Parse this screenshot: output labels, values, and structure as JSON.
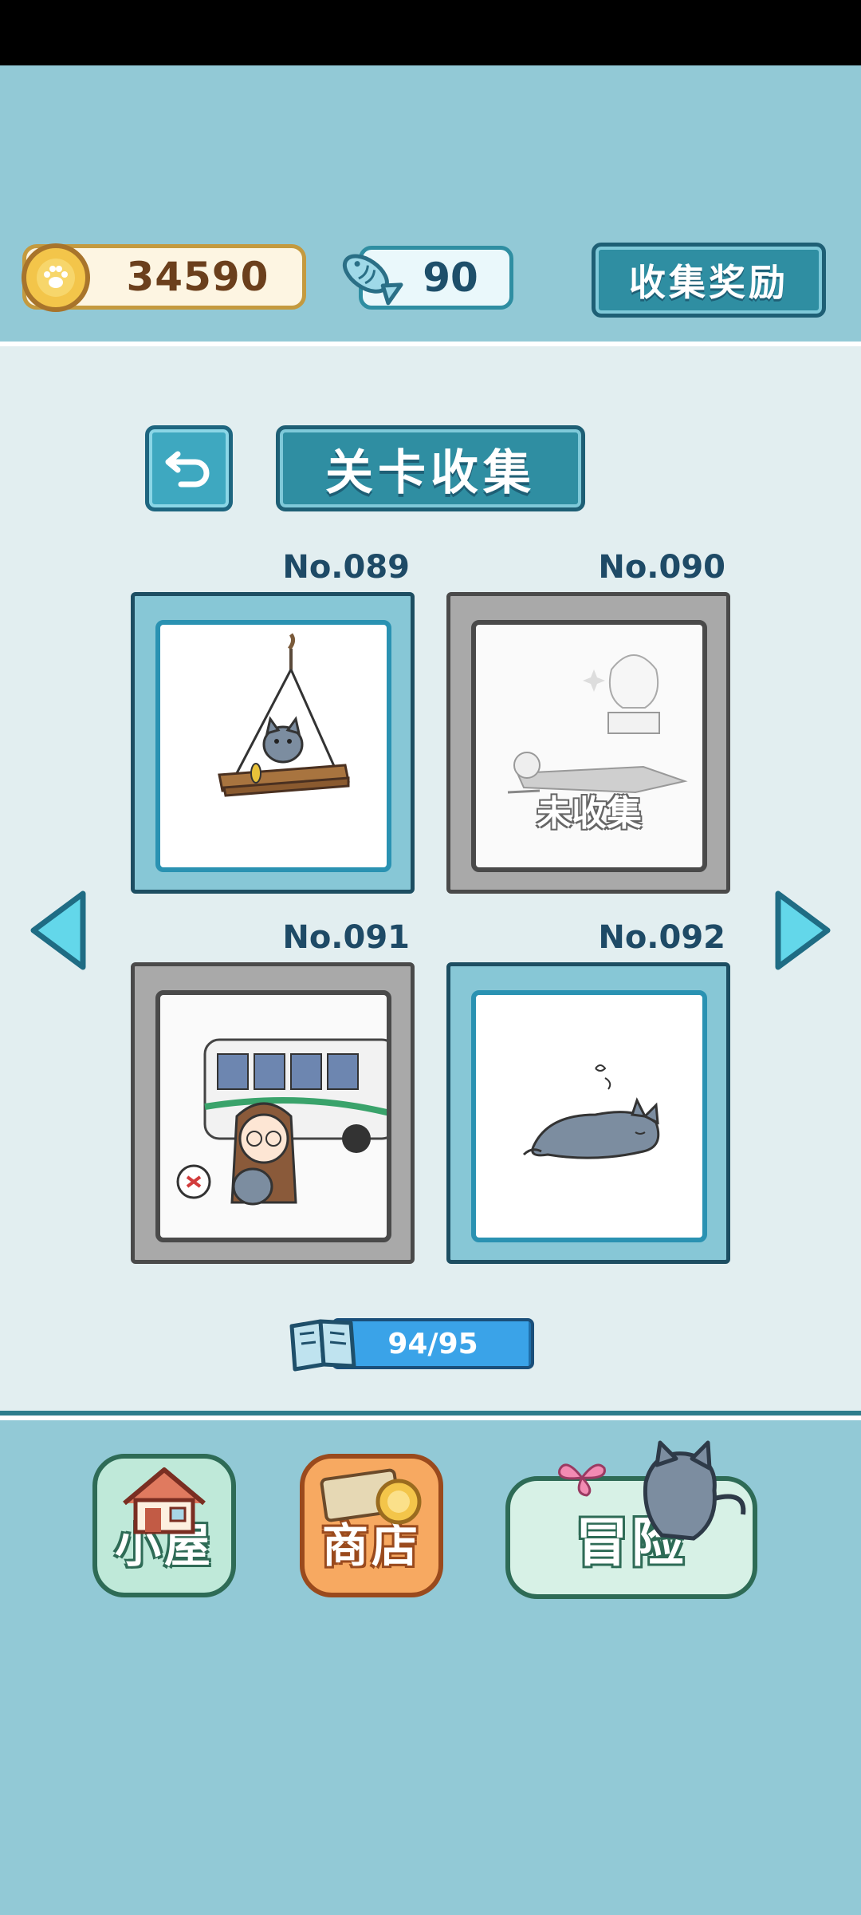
{
  "header": {
    "coins": "34590",
    "fish": "90",
    "reward_button": "收集奖励"
  },
  "page": {
    "title": "关卡收集"
  },
  "cards": [
    {
      "number": "No.089",
      "status": "collected",
      "label": ""
    },
    {
      "number": "No.090",
      "status": "locked",
      "label": "未收集"
    },
    {
      "number": "No.091",
      "status": "locked",
      "label": ""
    },
    {
      "number": "No.092",
      "status": "collected",
      "label": ""
    }
  ],
  "progress": {
    "text": "94/95",
    "fraction": 0.989
  },
  "nav": {
    "house": "小屋",
    "shop": "商店",
    "adventure": "冒险"
  },
  "colors": {
    "background": "#92c9d6",
    "panel": "#e2eef0",
    "accent": "#2f8ea2",
    "coin": "#f3c54a"
  }
}
